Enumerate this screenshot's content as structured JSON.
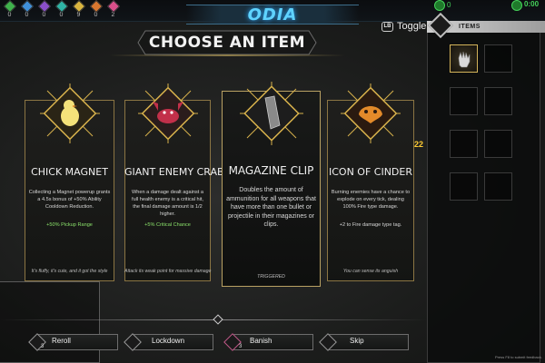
{
  "hud": {
    "resources": [
      {
        "icon": "green-gem-icon",
        "color": "#3fb24c",
        "count": "0"
      },
      {
        "icon": "blue-gem-icon",
        "color": "#3f8fd9",
        "count": "0"
      },
      {
        "icon": "purple-gem-icon",
        "color": "#8a4fc9",
        "count": "0"
      },
      {
        "icon": "teal-gem-icon",
        "color": "#2fb3a5",
        "count": "0"
      },
      {
        "icon": "yellow-gem-icon",
        "color": "#d9b43f",
        "count": "9"
      },
      {
        "icon": "orange-gem-icon",
        "color": "#d9762f",
        "count": "0"
      },
      {
        "icon": "pink-gem-icon",
        "color": "#d94f8a",
        "count": "2"
      }
    ],
    "logo": "ODIA",
    "currency": "0",
    "timer": "0:00"
  },
  "header": {
    "title": "CHOOSE AN ITEM"
  },
  "toggle": {
    "key": "LB",
    "label": "Toggle"
  },
  "items_panel": {
    "title": "ITEMS",
    "side_counter": "22"
  },
  "cards": [
    {
      "name": "CHICK MAGNET",
      "icon": "chick-icon",
      "desc": "Collecting a Magnet powerup grants a 4.5s bonus of +50% Ability Cooldown Reduction.",
      "stat": "+50% Pickup Range",
      "flavor": "It's fluffy, it's cute, and it got the style"
    },
    {
      "name": "GIANT ENEMY CRAB",
      "icon": "crab-icon",
      "desc": "When a damage dealt against a full health enemy is a critical hit, the final damage amount is 1/2 higher.",
      "stat": "+5% Critical Chance",
      "flavor": "Attack its weak point for massive damage"
    },
    {
      "name": "MAGAZINE CLIP",
      "icon": "magazine-clip-icon",
      "desc": "Doubles the amount of ammunition for all weapons that have more than one bullet or projectile in their magazines or clips.",
      "stat": "",
      "flavor": "TRIGGERED"
    },
    {
      "name": "ICON OF CINDER",
      "icon": "cinder-icon",
      "desc": "Burning enemies have a chance to explode on every tick, dealing 100% Fire type damage.",
      "stat": "+2 to Fire damage type tag.",
      "flavor": "You can sense its anguish"
    }
  ],
  "actions": [
    {
      "label": "Reroll",
      "count": "3"
    },
    {
      "label": "Lockdown",
      "count": ""
    },
    {
      "label": "Banish",
      "count": "3"
    },
    {
      "label": "Skip",
      "count": ""
    }
  ],
  "footer": {
    "feedback": "Press F8 to submit feedback."
  }
}
